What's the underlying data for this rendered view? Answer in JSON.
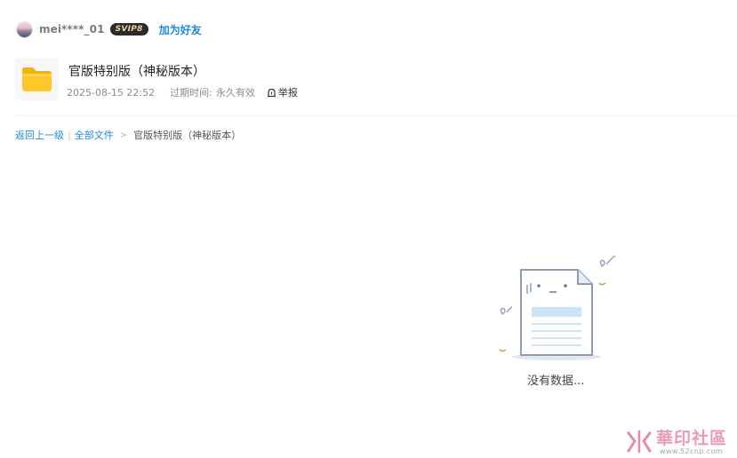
{
  "user": {
    "name": "mei****_01",
    "badge": "SVIP8",
    "add_friend": "加为好友"
  },
  "file": {
    "title": "官版特别版（神秘版本）",
    "date": "2025-08-15 22:52",
    "expiry_label": "过期时间:",
    "expiry_value": "永久有效",
    "report_label": "举报",
    "folder_icon": "folder-icon"
  },
  "breadcrumb": {
    "back": "返回上一级",
    "separator": "|",
    "all_files": "全部文件",
    "arrow": ">",
    "current": "官版特别版（神秘版本）"
  },
  "empty": {
    "text": "没有数据..."
  },
  "watermark": {
    "title": "華印社區",
    "url": "www.52cnp.com"
  },
  "colors": {
    "link": "#1e88e5",
    "folder": "#ffc72c",
    "badge_bg": "#2b2b2b",
    "badge_text": "#e9d2a6"
  }
}
